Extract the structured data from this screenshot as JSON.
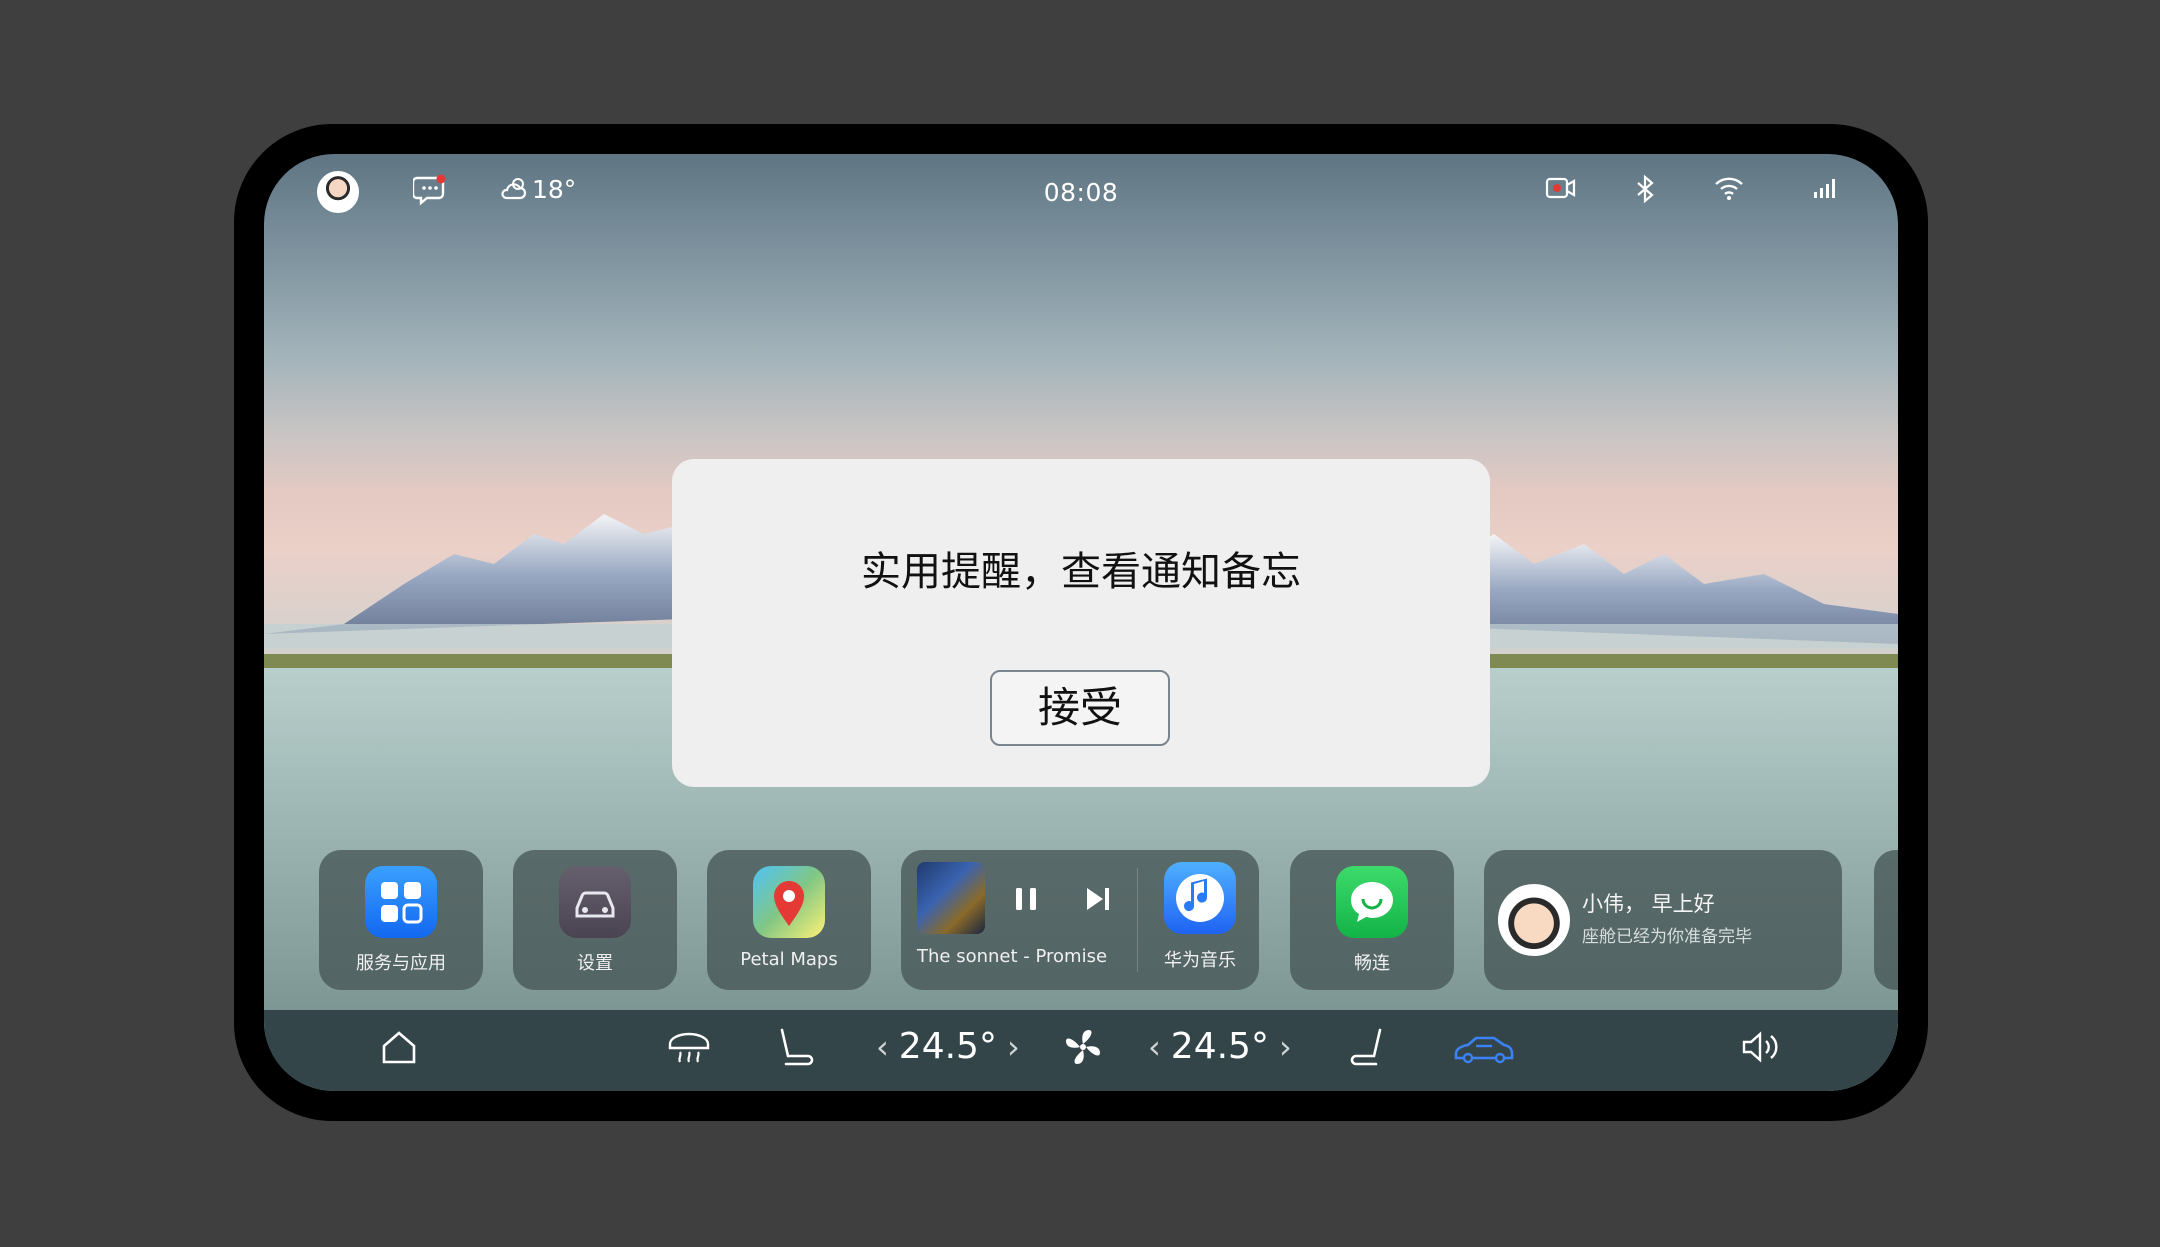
{
  "status_bar": {
    "time": "08:08",
    "weather_temp": "18°"
  },
  "dialog": {
    "message": "实用提醒，查看通知备忘",
    "accept_label": "接受"
  },
  "dock": {
    "apps": [
      {
        "label": "服务与应用"
      },
      {
        "label": "设置"
      },
      {
        "label": "Petal Maps"
      },
      {
        "label": "华为音乐"
      },
      {
        "label": "畅连"
      }
    ],
    "media": {
      "track": "The sonnet - Promise"
    },
    "greeting": {
      "title": "小伟， 早上好",
      "subtitle": "座舱已经为你准备完毕"
    }
  },
  "climate": {
    "left_temp": "24.5°",
    "right_temp": "24.5°"
  },
  "colors": {
    "accent_blue": "#3b82f6",
    "background": "#3f3f3f"
  }
}
